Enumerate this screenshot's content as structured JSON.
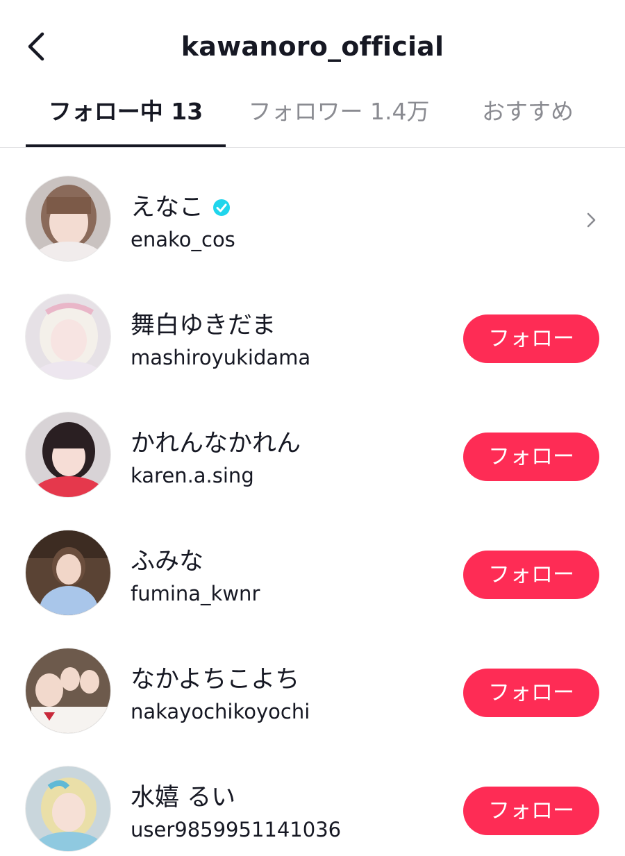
{
  "header": {
    "back_icon": "chevron-left-icon",
    "title": "kawanoro_official"
  },
  "tabs": [
    {
      "label": "フォロー中 13",
      "active": true
    },
    {
      "label": "フォロワー 1.4万",
      "active": false
    },
    {
      "label": "おすすめ",
      "active": false
    }
  ],
  "accent_color": "#fe2c55",
  "verified_color": "#20d5ec",
  "users": [
    {
      "name": "えなこ",
      "username": "enako_cos",
      "verified": true,
      "action": "chevron-right-icon"
    },
    {
      "name": "舞白ゆきだま",
      "username": "mashiroyukidama",
      "button": "フォロー"
    },
    {
      "name": "かれんなかれん",
      "username": "karen.a.sing",
      "button": "フォロー"
    },
    {
      "name": "ふみな",
      "username": "fumina_kwnr",
      "button": "フォロー"
    },
    {
      "name": "なかよちこよち",
      "username": "nakayochikoyochi",
      "button": "フォロー"
    },
    {
      "name": "水嬉 るい",
      "username": "user9859951141036",
      "button": "フォロー"
    }
  ]
}
